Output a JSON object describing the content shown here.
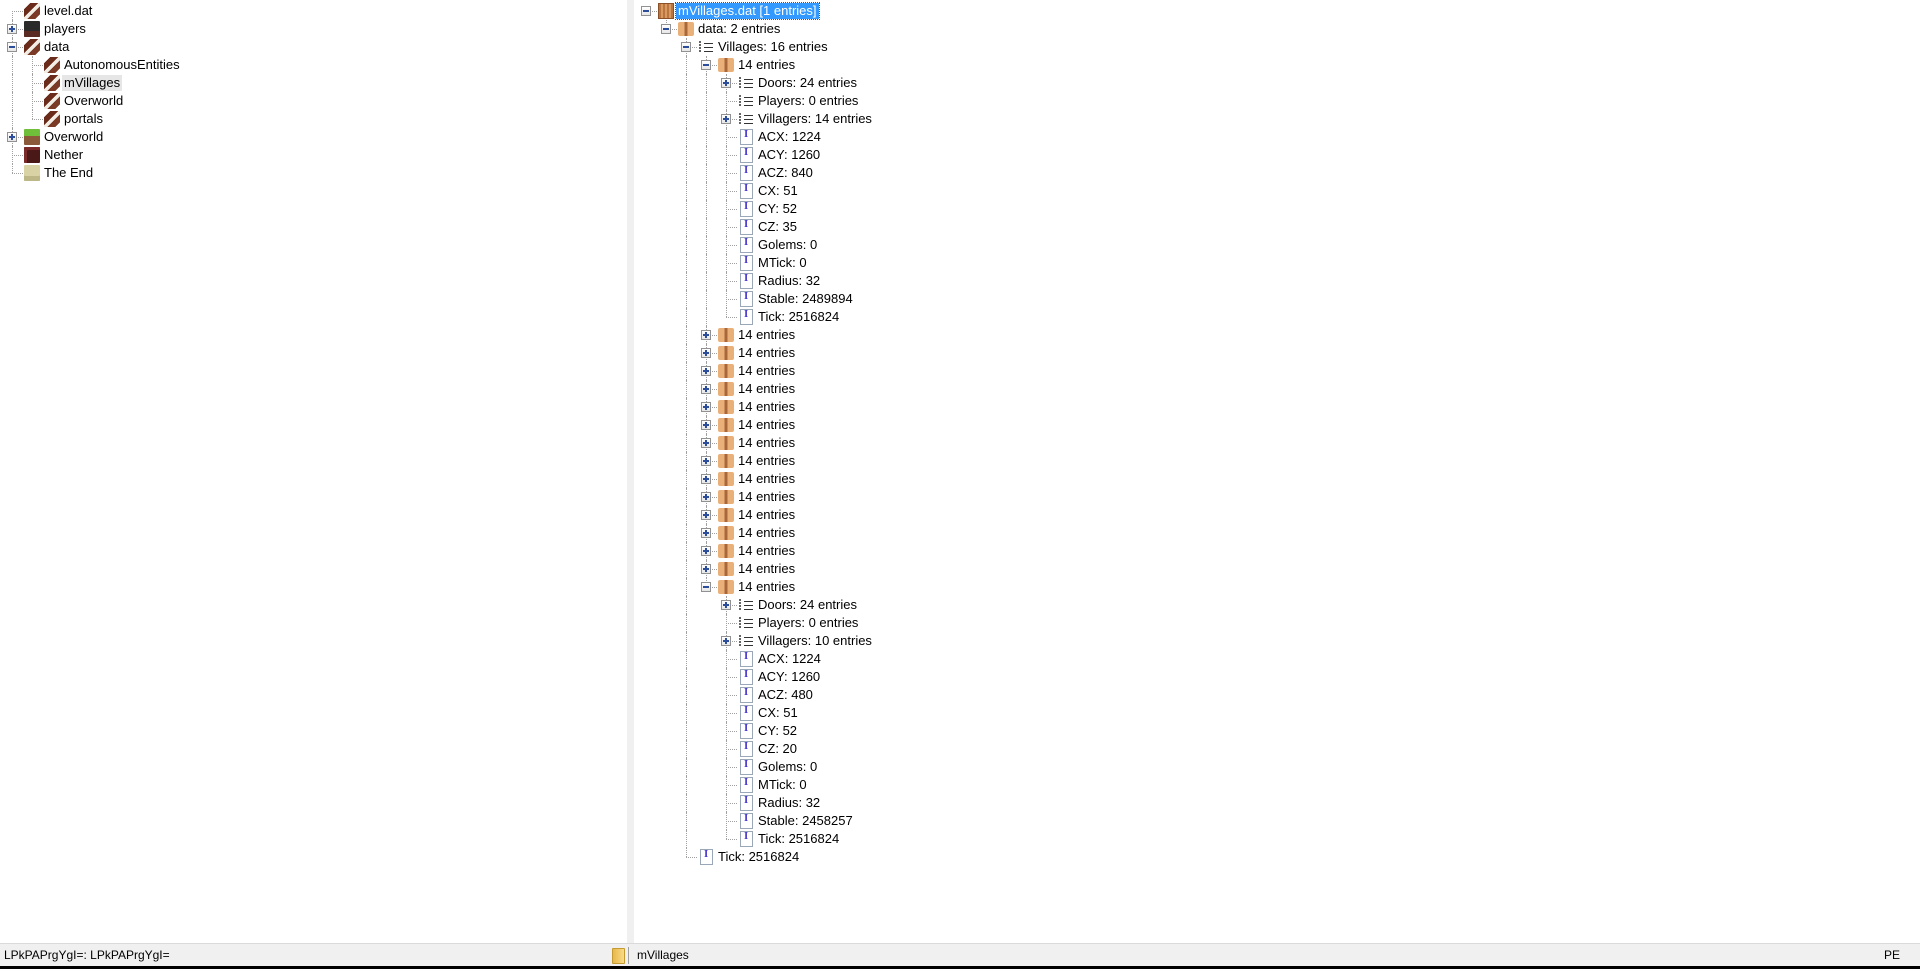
{
  "left_tree": [
    {
      "label": "level.dat",
      "icon": "book"
    },
    {
      "label": "players",
      "icon": "players",
      "toggle": "plus"
    },
    {
      "label": "data",
      "icon": "book",
      "toggle": "minus",
      "children": [
        {
          "label": "AutonomousEntities",
          "icon": "book"
        },
        {
          "label": "mVillages",
          "icon": "book",
          "selected": "inactive"
        },
        {
          "label": "Overworld",
          "icon": "book"
        },
        {
          "label": "portals",
          "icon": "book"
        }
      ]
    },
    {
      "label": "Overworld",
      "icon": "grass",
      "toggle": "plus"
    },
    {
      "label": "Nether",
      "icon": "nether"
    },
    {
      "label": "The End",
      "icon": "end"
    }
  ],
  "right_tree": [
    {
      "label": "mVillages.dat [1 entries]",
      "icon": "region",
      "toggle": "minus",
      "selected": "active",
      "children": [
        {
          "label": "data: 2 entries",
          "icon": "compound",
          "toggle": "minus",
          "children": [
            {
              "label": "Villages: 16 entries",
              "icon": "list",
              "toggle": "minus",
              "children": [
                {
                  "label": "14 entries",
                  "icon": "compound",
                  "toggle": "minus",
                  "children": [
                    {
                      "label": "Doors: 24 entries",
                      "icon": "list",
                      "toggle": "plus"
                    },
                    {
                      "label": "Players: 0 entries",
                      "icon": "list"
                    },
                    {
                      "label": "Villagers: 14 entries",
                      "icon": "list",
                      "toggle": "plus"
                    },
                    {
                      "label": "ACX: 1224",
                      "icon": "int"
                    },
                    {
                      "label": "ACY: 1260",
                      "icon": "int"
                    },
                    {
                      "label": "ACZ: 840",
                      "icon": "int"
                    },
                    {
                      "label": "CX: 51",
                      "icon": "int"
                    },
                    {
                      "label": "CY: 52",
                      "icon": "int"
                    },
                    {
                      "label": "CZ: 35",
                      "icon": "int"
                    },
                    {
                      "label": "Golems: 0",
                      "icon": "int"
                    },
                    {
                      "label": "MTick: 0",
                      "icon": "int"
                    },
                    {
                      "label": "Radius: 32",
                      "icon": "int"
                    },
                    {
                      "label": "Stable: 2489894",
                      "icon": "int"
                    },
                    {
                      "label": "Tick: 2516824",
                      "icon": "int"
                    }
                  ]
                },
                {
                  "label": "14 entries",
                  "icon": "compound",
                  "toggle": "plus"
                },
                {
                  "label": "14 entries",
                  "icon": "compound",
                  "toggle": "plus"
                },
                {
                  "label": "14 entries",
                  "icon": "compound",
                  "toggle": "plus"
                },
                {
                  "label": "14 entries",
                  "icon": "compound",
                  "toggle": "plus"
                },
                {
                  "label": "14 entries",
                  "icon": "compound",
                  "toggle": "plus"
                },
                {
                  "label": "14 entries",
                  "icon": "compound",
                  "toggle": "plus"
                },
                {
                  "label": "14 entries",
                  "icon": "compound",
                  "toggle": "plus"
                },
                {
                  "label": "14 entries",
                  "icon": "compound",
                  "toggle": "plus"
                },
                {
                  "label": "14 entries",
                  "icon": "compound",
                  "toggle": "plus"
                },
                {
                  "label": "14 entries",
                  "icon": "compound",
                  "toggle": "plus"
                },
                {
                  "label": "14 entries",
                  "icon": "compound",
                  "toggle": "plus"
                },
                {
                  "label": "14 entries",
                  "icon": "compound",
                  "toggle": "plus"
                },
                {
                  "label": "14 entries",
                  "icon": "compound",
                  "toggle": "plus"
                },
                {
                  "label": "14 entries",
                  "icon": "compound",
                  "toggle": "plus"
                },
                {
                  "label": "14 entries",
                  "icon": "compound",
                  "toggle": "minus",
                  "children": [
                    {
                      "label": "Doors: 24 entries",
                      "icon": "list",
                      "toggle": "plus"
                    },
                    {
                      "label": "Players: 0 entries",
                      "icon": "list"
                    },
                    {
                      "label": "Villagers: 10 entries",
                      "icon": "list",
                      "toggle": "plus"
                    },
                    {
                      "label": "ACX: 1224",
                      "icon": "int"
                    },
                    {
                      "label": "ACY: 1260",
                      "icon": "int"
                    },
                    {
                      "label": "ACZ: 480",
                      "icon": "int"
                    },
                    {
                      "label": "CX: 51",
                      "icon": "int"
                    },
                    {
                      "label": "CY: 52",
                      "icon": "int"
                    },
                    {
                      "label": "CZ: 20",
                      "icon": "int"
                    },
                    {
                      "label": "Golems: 0",
                      "icon": "int"
                    },
                    {
                      "label": "MTick: 0",
                      "icon": "int"
                    },
                    {
                      "label": "Radius: 32",
                      "icon": "int"
                    },
                    {
                      "label": "Stable: 2458257",
                      "icon": "int"
                    },
                    {
                      "label": "Tick: 2516824",
                      "icon": "int"
                    }
                  ]
                }
              ]
            },
            {
              "label": "Tick: 2516824",
              "icon": "int"
            }
          ]
        }
      ]
    }
  ],
  "statusbar": {
    "left_text": "LPkPAPrgYgI=: LPkPAPrgYgI=",
    "folder_icon": "folder-icon",
    "middle_text": "mVillages",
    "right_text": "PE"
  },
  "colors": {
    "selection": "#3399ff",
    "inactive_selection": "#e6e6e6",
    "statusbar": "#f0f0f0"
  }
}
